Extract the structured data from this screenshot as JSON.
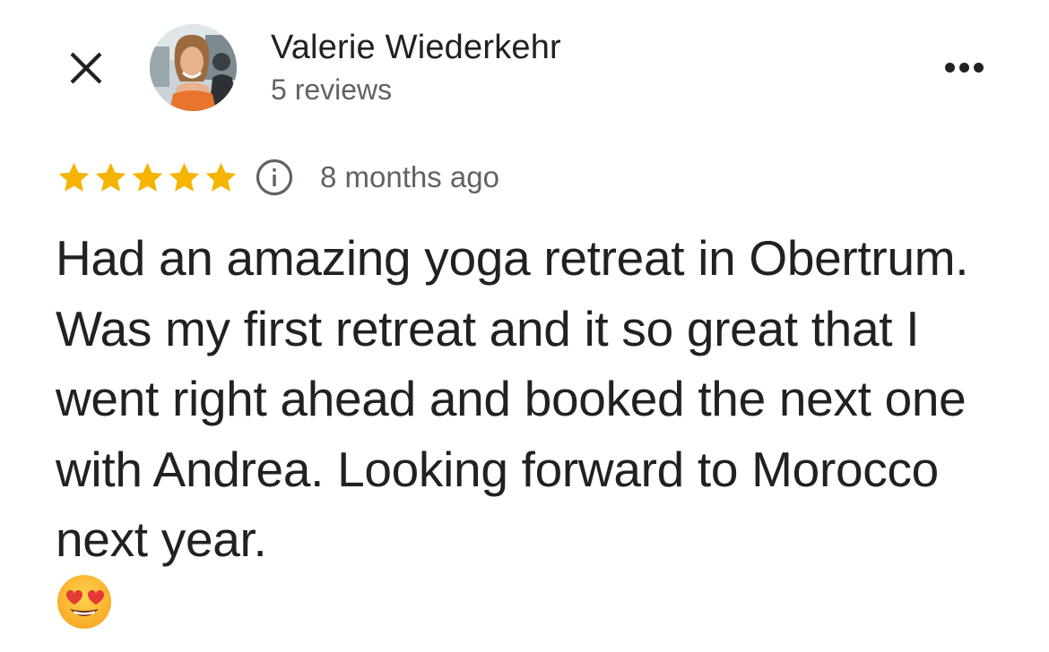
{
  "header": {
    "reviewer_name": "Valerie Wiederkehr",
    "review_count": "5 reviews",
    "close_icon": "close-icon",
    "more_icon": "more-horiz-icon"
  },
  "review": {
    "rating": 5,
    "rating_max": 5,
    "star_color": "#F4B400",
    "date": "8 months ago",
    "text": "Had an amazing yoga retreat in Obertrum. Was my first retreat and it so great that I went right ahead and booked the next one with Andrea. Looking forward to Morocco next year.",
    "emoji": "heart-eyes-emoji"
  }
}
